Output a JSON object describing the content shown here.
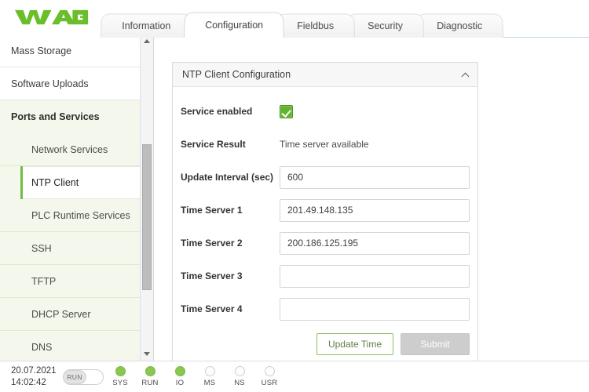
{
  "brand": {
    "logo_text": "WAGO",
    "logo_color": "#6ABD2B"
  },
  "tabs": [
    {
      "label": "Information",
      "active": false
    },
    {
      "label": "Configuration",
      "active": true
    },
    {
      "label": "Fieldbus",
      "active": false
    },
    {
      "label": "Security",
      "active": false
    },
    {
      "label": "Diagnostic",
      "active": false
    }
  ],
  "sidebar": {
    "items": [
      {
        "label": "Mass Storage",
        "type": "item"
      },
      {
        "label": "Software Uploads",
        "type": "item"
      },
      {
        "label": "Ports and Services",
        "type": "group"
      },
      {
        "label": "Network Services",
        "type": "sub"
      },
      {
        "label": "NTP Client",
        "type": "sub",
        "active": true
      },
      {
        "label": "PLC Runtime Services",
        "type": "sub"
      },
      {
        "label": "SSH",
        "type": "sub"
      },
      {
        "label": "TFTP",
        "type": "sub"
      },
      {
        "label": "DHCP Server",
        "type": "sub"
      },
      {
        "label": "DNS",
        "type": "sub"
      }
    ],
    "scroll_up_icon": "triangle-up-icon",
    "scroll_down_icon": "triangle-down-icon"
  },
  "panel": {
    "title": "NTP Client Configuration",
    "collapse_icon": "chevron-up-icon",
    "rows": {
      "service_enabled_label": "Service enabled",
      "service_enabled_checked": true,
      "service_result_label": "Service Result",
      "service_result_value": "Time server available",
      "update_interval_label": "Update Interval (sec)",
      "update_interval_value": "600",
      "time_server_1_label": "Time Server 1",
      "time_server_1_value": "201.49.148.135",
      "time_server_2_label": "Time Server 2",
      "time_server_2_value": "200.186.125.195",
      "time_server_3_label": "Time Server 3",
      "time_server_3_value": "",
      "time_server_4_label": "Time Server 4",
      "time_server_4_value": ""
    },
    "buttons": {
      "update_time": "Update Time",
      "submit": "Submit"
    }
  },
  "footer": {
    "date": "20.07.2021",
    "time": "14:02:42",
    "toggle_label": "RUN",
    "leds": [
      {
        "name": "SYS",
        "on": true
      },
      {
        "name": "RUN",
        "on": true
      },
      {
        "name": "IO",
        "on": true
      },
      {
        "name": "MS",
        "on": false
      },
      {
        "name": "NS",
        "on": false
      },
      {
        "name": "USR",
        "on": false
      }
    ]
  }
}
